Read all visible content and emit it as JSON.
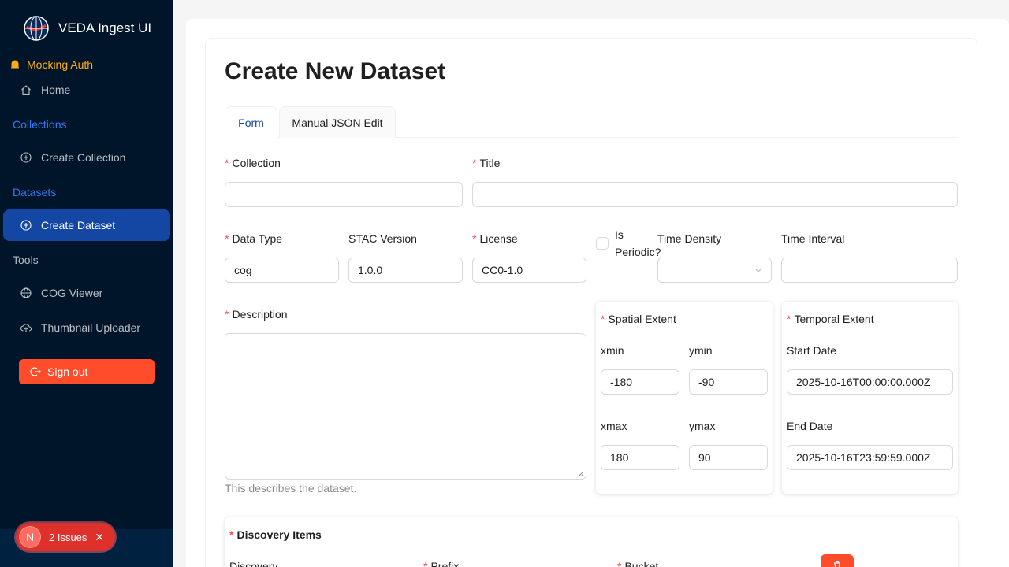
{
  "sidebar": {
    "app_name": "VEDA Ingest UI",
    "auth_status": "Mocking Auth",
    "home": "Home",
    "collections_group": "Collections",
    "create_collection": "Create Collection",
    "datasets_group": "Datasets",
    "create_dataset": "Create Dataset",
    "tools_group": "Tools",
    "cog_viewer": "COG Viewer",
    "thumbnail_uploader": "Thumbnail Uploader",
    "sign_out": "Sign out"
  },
  "issues_badge": {
    "avatar": "N",
    "label": "2 Issues"
  },
  "page": {
    "title": "Create New Dataset",
    "tabs": [
      "Form",
      "Manual JSON Edit"
    ]
  },
  "form": {
    "collection": {
      "label": "Collection",
      "value": ""
    },
    "title": {
      "label": "Title",
      "value": ""
    },
    "data_type": {
      "label": "Data Type",
      "value": "cog"
    },
    "stac_version": {
      "label": "STAC Version",
      "value": "1.0.0"
    },
    "license": {
      "label": "License",
      "value": "CC0-1.0"
    },
    "is_periodic": {
      "label_line1": "Is",
      "label_line2": "Periodic?",
      "checked": false
    },
    "time_density": {
      "label": "Time Density",
      "value": ""
    },
    "time_interval": {
      "label": "Time Interval",
      "value": ""
    },
    "description": {
      "label": "Description",
      "value": "",
      "help": "This describes the dataset."
    },
    "spatial_extent": {
      "title": "Spatial Extent",
      "xmin": {
        "label": "xmin",
        "value": "-180"
      },
      "ymin": {
        "label": "ymin",
        "value": "-90"
      },
      "xmax": {
        "label": "xmax",
        "value": "180"
      },
      "ymax": {
        "label": "ymax",
        "value": "90"
      }
    },
    "temporal_extent": {
      "title": "Temporal Extent",
      "start": {
        "label": "Start Date",
        "value": "2025-10-16T00:00:00.000Z"
      },
      "end": {
        "label": "End Date",
        "value": "2025-10-16T23:59:59.000Z"
      }
    },
    "discovery_items": {
      "title": "Discovery Items",
      "col_discovery": "Discovery",
      "col_prefix": "Prefix",
      "col_bucket": "Bucket"
    }
  },
  "colors": {
    "sidebar_bg": "#001529",
    "active_nav": "#1447a4",
    "accent_blue": "#2f7bf5",
    "danger": "#ff4d2b",
    "auth_warning": "#faad14"
  }
}
